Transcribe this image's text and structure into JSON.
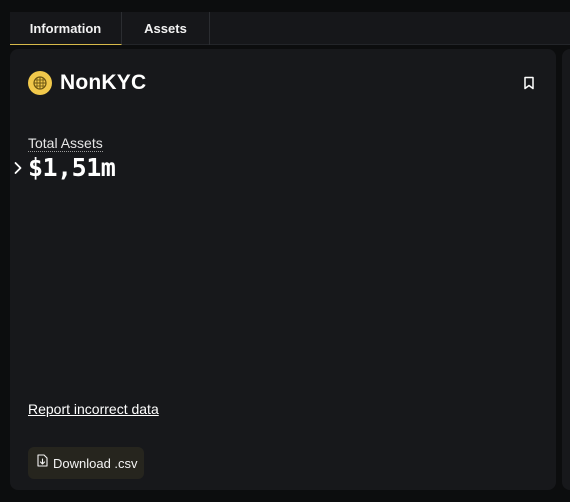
{
  "tabs": [
    {
      "label": "Information",
      "active": true
    },
    {
      "label": "Assets",
      "active": false
    }
  ],
  "entity": {
    "name": "NonKYC",
    "logo_icon": "globe-grid-icon",
    "logo_color": "#f1c84b"
  },
  "total_assets": {
    "label": "Total Assets",
    "value": "$1,51m"
  },
  "links": {
    "report": "Report incorrect data"
  },
  "actions": {
    "download_label": "Download .csv",
    "download_icon": "file-download-icon"
  },
  "colors": {
    "background": "#0c0d0e",
    "panel": "#17181b",
    "accent": "#d7b94a",
    "button_bg": "#26251e"
  }
}
